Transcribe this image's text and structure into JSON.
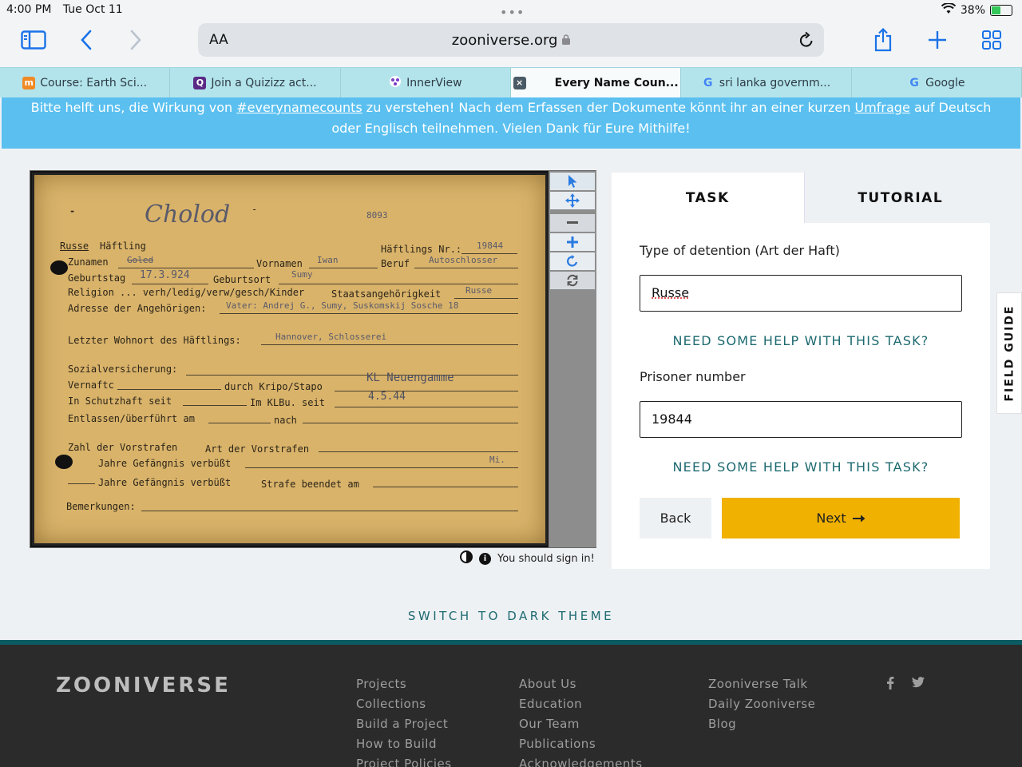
{
  "status": {
    "time": "4:00 PM",
    "date": "Tue Oct 11",
    "battery": "38%"
  },
  "browser": {
    "aa": "AA",
    "domain": "zooniverse.org",
    "tabs": [
      {
        "label": "Course: Earth Sci...",
        "icon": "moodle-icon",
        "color": "#f08a24"
      },
      {
        "label": "Join a Quizizz act...",
        "icon": "quizizz-icon",
        "color": "#5b2a86"
      },
      {
        "label": "InnerView",
        "icon": "innerview-icon",
        "color": "#7a3cc9"
      },
      {
        "label": "Every Name Coun...",
        "icon": "zooniverse-tab-icon",
        "color": "#4a5a66"
      },
      {
        "label": "sri lanka governm...",
        "icon": "google-icon",
        "color": "#4285f4"
      },
      {
        "label": "Google",
        "icon": "google-icon",
        "color": "#4285f4"
      }
    ]
  },
  "banner": {
    "pre": "Bitte helft uns, die Wirkung von ",
    "link1": "#everynamecounts",
    "mid": " zu verstehen! Nach dem Erfassen der Dokumente könnt ihr an einer kurzen ",
    "link2": "Umfrage",
    "post": " auf Deutsch",
    "line2": "oder Englisch teilnehmen. Vielen Dank für Eure Mithilfe!"
  },
  "card": {
    "signature": "Cholod",
    "number": "8093",
    "type": "Russe",
    "haeftling": "Häftling",
    "haeftlings_nr_label": "Häftlings Nr.:",
    "haeftlings_nr": "19844",
    "zunamen_label": "Zunamen",
    "zunamen": "Goled",
    "vornamen_label": "Vornamen",
    "vornamen": "Iwan",
    "beruf_label": "Beruf",
    "beruf": "Autoschlosser",
    "geburtstag_label": "Geburtstag",
    "geburtstag": "17.3.924",
    "geburtsort_label": "Geburtsort",
    "geburtsort": "Sumy",
    "religion_label": "Religion ... verh/ledig/verw/gesch/Kinder",
    "staat_label": "Staatsangehörigkeit",
    "staat": "Russe",
    "adresse_label": "Adresse der Angehörigen:",
    "adresse": "Vater: Andrej G., Sumy, Suskomskij Sosche 18",
    "wohnort_label": "Letzter Wohnort des Häftlings:",
    "wohnort": "Hannover, Schlosserei",
    "sozial_label": "Sozialversicherung:",
    "vernaft_label": "Vernaftc",
    "kripo_label": "durch Kripo/Stapo",
    "stamp": "KL Neuengamme",
    "schutzhaft_label": "In Schutzhaft seit",
    "klbu_label": "Im KLBu. seit",
    "klbu_date": "4.5.44",
    "entlassen_label": "Entlassen/überführt am",
    "nach_label": "nach",
    "vorstrafen_label": "Zahl der Vorstrafen",
    "art_label": "Art der Vorstrafen",
    "jahre1_label": "Jahre Gefängnis verbüßt",
    "mi": "Mi.",
    "jahre2_label": "Jahre Gefängnis verbüßt",
    "strafe_label": "Strafe beendet am",
    "bemerkungen_label": "Bemerkungen:"
  },
  "viewer": {
    "signin": "You should sign in!"
  },
  "panel": {
    "tab_task": "TASK",
    "tab_tutorial": "TUTORIAL",
    "q1_label": "Type of detention (Art der Haft)",
    "q1_value": "Russe",
    "help1": "NEED SOME HELP WITH THIS TASK?",
    "q2_label": "Prisoner number",
    "q2_value": "19844",
    "help2": "NEED SOME HELP WITH THIS TASK?",
    "back": "Back",
    "next": "Next"
  },
  "field_guide": "FIELD GUIDE",
  "dark_theme": "SWITCH TO DARK THEME",
  "footer": {
    "logo": "ZOONIVERSE",
    "col1": [
      "Projects",
      "Collections",
      "Build a Project",
      "How to Build",
      "Project Policies"
    ],
    "col2": [
      "About Us",
      "Education",
      "Our Team",
      "Publications",
      "Acknowledgements"
    ],
    "col3": [
      "Zooniverse Talk",
      "Daily Zooniverse",
      "Blog"
    ]
  }
}
